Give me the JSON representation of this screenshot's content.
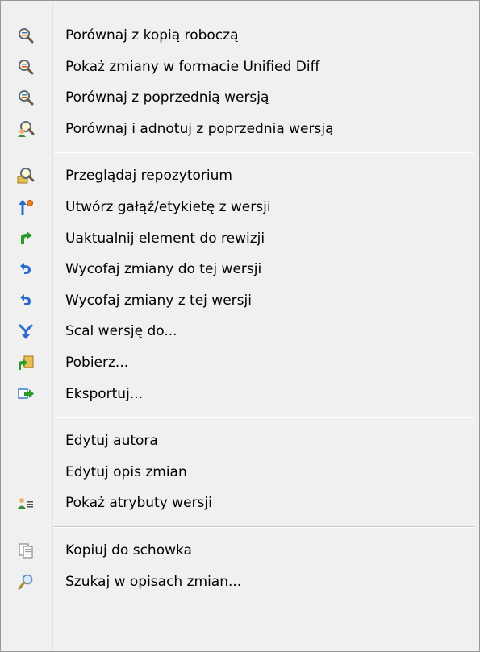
{
  "menu": {
    "groups": [
      {
        "items": [
          {
            "label": "Porównaj z kopią roboczą",
            "icon": "magnifier-compare-icon"
          },
          {
            "label": "Pokaż zmiany w formacie Unified Diff",
            "icon": "magnifier-compare-icon"
          },
          {
            "label": "Porównaj z poprzednią wersją",
            "icon": "magnifier-compare-icon"
          },
          {
            "label": "Porównaj i adnotuj z poprzednią wersją",
            "icon": "magnifier-person-icon"
          }
        ]
      },
      {
        "items": [
          {
            "label": "Przeglądaj repozytorium",
            "icon": "magnifier-folder-icon"
          },
          {
            "label": "Utwórz gałąź/etykietę z wersji",
            "icon": "branch-tag-icon"
          },
          {
            "label": "Uaktualnij element do rewizji",
            "icon": "green-arrow-icon"
          },
          {
            "label": "Wycofaj zmiany do tej wersji",
            "icon": "undo-arrow-icon"
          },
          {
            "label": "Wycofaj zmiany z tej wersji",
            "icon": "undo-arrow-icon"
          },
          {
            "label": "Scal wersję do...",
            "icon": "merge-icon"
          },
          {
            "label": "Pobierz...",
            "icon": "checkout-icon"
          },
          {
            "label": "Eksportuj...",
            "icon": "export-icon"
          }
        ]
      },
      {
        "items": [
          {
            "label": "Edytuj autora",
            "icon": ""
          },
          {
            "label": "Edytuj opis zmian",
            "icon": ""
          },
          {
            "label": "Pokaż atrybuty wersji",
            "icon": "properties-icon"
          }
        ]
      },
      {
        "items": [
          {
            "label": "Kopiuj do schowka",
            "icon": "clipboard-icon"
          },
          {
            "label": "Szukaj w opisach zmian...",
            "icon": "search-icon"
          }
        ]
      }
    ]
  }
}
